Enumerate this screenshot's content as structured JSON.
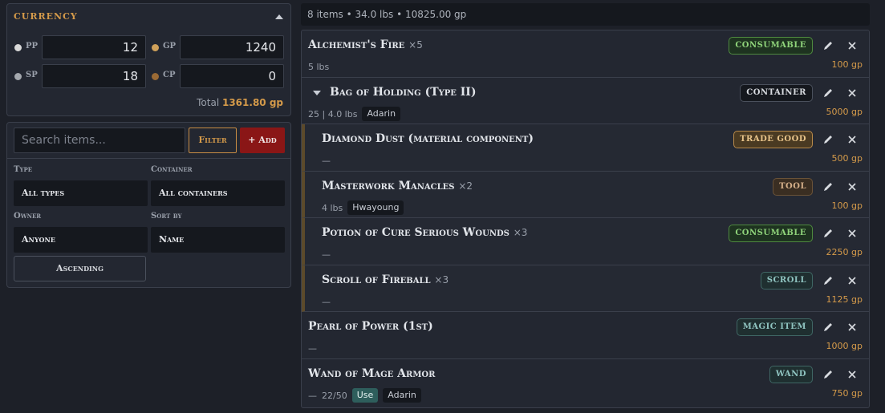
{
  "currency": {
    "title": "CURRENCY",
    "coins": [
      {
        "code": "PP",
        "value": "12",
        "color": "#d9d9d9"
      },
      {
        "code": "GP",
        "value": "1240",
        "color": "#d0a15a"
      },
      {
        "code": "SP",
        "value": "18",
        "color": "#a4a8ae"
      },
      {
        "code": "CP",
        "value": "0",
        "color": "#9a6a35"
      }
    ],
    "total_label": "Total",
    "total_value": "1361.80 gp"
  },
  "filters": {
    "search_placeholder": "Search items...",
    "filter_label": "Filter",
    "add_label": "+ Add",
    "type_label": "Type",
    "type_value": "All types",
    "container_label": "Container",
    "container_value": "All containers",
    "owner_label": "Owner",
    "owner_value": "Anyone",
    "sort_label": "Sort by",
    "sort_value": "Name",
    "order_label": "Ascending"
  },
  "summary": "8 items • 34.0 lbs • 10825.00 gp",
  "badge_colors": {
    "consumable": {
      "text": "#8fd37a",
      "border": "#4f8a3f",
      "bg": "#1e3320"
    },
    "container": {
      "text": "#d8dbe0",
      "border": "#4a505c",
      "bg": "#15181e"
    },
    "trade_good": {
      "text": "#e8c48a",
      "border": "#b98a4a",
      "bg": "#4a3a22"
    },
    "tool": {
      "text": "#d6b08a",
      "border": "#6a5238",
      "bg": "#3a2e22"
    },
    "scroll": {
      "text": "#8fc4c0",
      "border": "#3f6664",
      "bg": "#1f2f30"
    },
    "magic_item": {
      "text": "#8fc4c0",
      "border": "#3f6664",
      "bg": "#1f2f30"
    },
    "wand": {
      "text": "#8fc4c0",
      "border": "#3f6664",
      "bg": "#1f2f30"
    }
  },
  "items": [
    {
      "name": "Alchemist's Fire",
      "qty": "×5",
      "badge": "CONSUMABLE",
      "meta": "5 lbs",
      "price": "100 gp"
    },
    {
      "name": "Bag of Holding (Type II)",
      "qty": "",
      "badge": "CONTAINER",
      "meta": "25 | 4.0 lbs",
      "owner": "Adarin",
      "price": "5000 gp"
    },
    {
      "name": "Diamond Dust (material component)",
      "qty": "",
      "badge": "TRADE GOOD",
      "meta": "—",
      "price": "500 gp"
    },
    {
      "name": "Masterwork Manacles",
      "qty": "×2",
      "badge": "TOOL",
      "meta": "4 lbs",
      "owner": "Hwayoung",
      "price": "100 gp"
    },
    {
      "name": "Potion of Cure Serious Wounds",
      "qty": "×3",
      "badge": "CONSUMABLE",
      "meta": "—",
      "price": "2250 gp"
    },
    {
      "name": "Scroll of Fireball",
      "qty": "×3",
      "badge": "SCROLL",
      "meta": "—",
      "price": "1125 gp"
    },
    {
      "name": "Pearl of Power (1st)",
      "qty": "",
      "badge": "MAGIC ITEM",
      "meta": "—",
      "price": "1000 gp"
    },
    {
      "name": "Wand of Mage Armor",
      "qty": "",
      "badge": "WAND",
      "meta": "—",
      "charges": "22/50",
      "use_label": "Use",
      "owner": "Adarin",
      "price": "750 gp"
    }
  ]
}
